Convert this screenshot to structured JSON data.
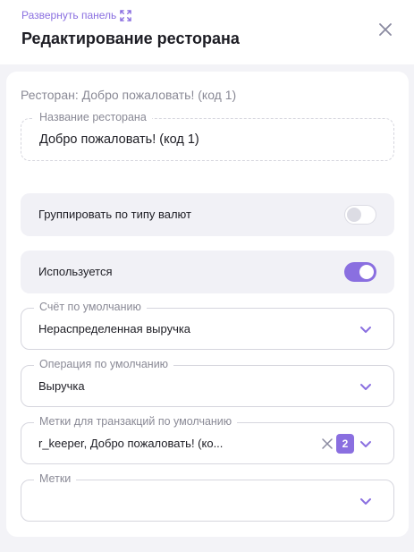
{
  "header": {
    "expand_label": "Развернуть панель",
    "title": "Редактирование ресторана"
  },
  "form": {
    "subtitle": "Ресторан: Добро пожаловать! (код 1)",
    "name_field": {
      "label": "Название ресторана",
      "value": "Добро пожаловать! (код 1)"
    },
    "group_by_currency": {
      "label": "Группировать по типу валют",
      "enabled": false
    },
    "in_use": {
      "label": "Используется",
      "enabled": true
    },
    "default_account": {
      "label": "Счёт по умолчанию",
      "value": "Нераспределенная выручка"
    },
    "default_operation": {
      "label": "Операция по умолчанию",
      "value": "Выручка"
    },
    "default_tx_tags": {
      "label": "Метки для транзакций по умолчанию",
      "value": "r_keeper, Добро пожаловать! (ко...",
      "count": "2"
    },
    "tags": {
      "label": "Метки",
      "value": ""
    }
  },
  "colors": {
    "accent": "#8a6fe0",
    "background": "#f3f3f7"
  },
  "icons": [
    "expand-icon",
    "close-icon",
    "chevron-down-icon",
    "clear-icon"
  ]
}
